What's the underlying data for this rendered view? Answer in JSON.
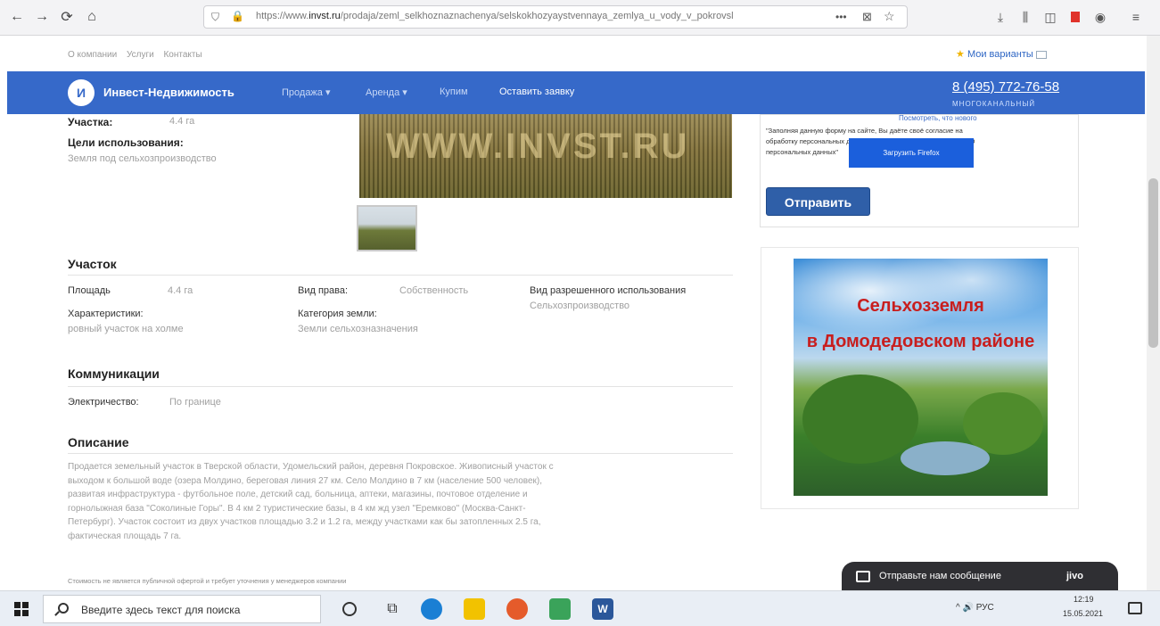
{
  "browser": {
    "url_prefix": "https://www.",
    "url_domain": "invst.ru",
    "url_path": "/prodaja/zeml_selkhoznaznachenya/selskokhozyaystvennaya_zemlya_u_vody_v_pokrovsl",
    "more_label": "•••"
  },
  "toplinks": [
    "О компании",
    "Услуги",
    "Контакты"
  ],
  "my_variants": "Мои варианты",
  "nav": {
    "logo": "И",
    "brand": "Инвест-Недвижимость",
    "links": [
      "Продажа ▾",
      "Аренда ▾",
      "Купим",
      "Оставить заявку"
    ],
    "phone": "8 (495) 772-76-58",
    "phone_sub": "МНОГОКАНАЛЬНЫЙ"
  },
  "summary": {
    "area_label": "Участка:",
    "area_value": "4.4 га",
    "purpose_label": "Цели использования:",
    "purpose_value": "Земля под сельхозпроизводство"
  },
  "photo": {
    "watermark": "WWW.INVST.RU"
  },
  "form": {
    "ff_link": "Посмотреть, что нового",
    "note_1": "\"Заполняя данную форму на сайте, Вы даёте своё согласие на",
    "note_2": "обработку персональных данных в соответствии с ФЗ №152-ФЗ \"О",
    "note_3": "персональных данных\"",
    "ff_banner": "Загрузить Firefox",
    "send": "Отправить"
  },
  "section_plot": {
    "title": "Участок",
    "area_label": "Площадь",
    "area_value": "4.4 га",
    "rights_label": "Вид права:",
    "rights_value": "Собственность",
    "use_label": "Вид разрешенного использования",
    "use_value": "Сельхозпроизводство",
    "char_label": "Характеристики:",
    "char_value": "ровный участок на холме",
    "cat_label": "Категория земли:",
    "cat_value": "Земли сельхозназначения"
  },
  "section_comm": {
    "title": "Коммуникации",
    "elec_label": "Электричество:",
    "elec_value": "По границе"
  },
  "section_desc": {
    "title": "Описание",
    "lines": [
      "Продается земельный участок в Тверской области, Удомельский район, деревня Покровское. Живописный участок с",
      "выходом к большой воде (озера Молдино, береговая линия 27 км. Село Молдино в 7 км (население 500 человек),",
      "развитая инфраструктура - футбольное поле, детский сад, больница, аптеки, магазины, почтовое отделение и",
      "горнолыжная база \"Соколиные Горы\". В 4 км 2 туристические базы, в 4 км жд узел \"Еремково\" (Москва-Санкт-",
      "Петербург). Участок состоит из двух участков площадью 3.2 и 1.2 га, между участками как бы затопленных 2.5 га,",
      "фактическая площадь 7 га."
    ],
    "disclaimer": "Стоимость не является публичной офертой и требует уточнения у менеджеров компании"
  },
  "ad": {
    "line1": "Сельхозземля",
    "line2": "в Домодедовском районе"
  },
  "chat": {
    "text": "Отправьте нам сообщение",
    "brand": "jivo"
  },
  "taskbar": {
    "search_placeholder": "Введите здесь текст для поиска",
    "tray": "^ 🔊 РУС",
    "time": "12:19",
    "date": "15.05.2021"
  },
  "colors": {
    "nav_blue": "#3669c9",
    "button_blue": "#2f5fa8",
    "ad_red": "#c81e1e"
  }
}
